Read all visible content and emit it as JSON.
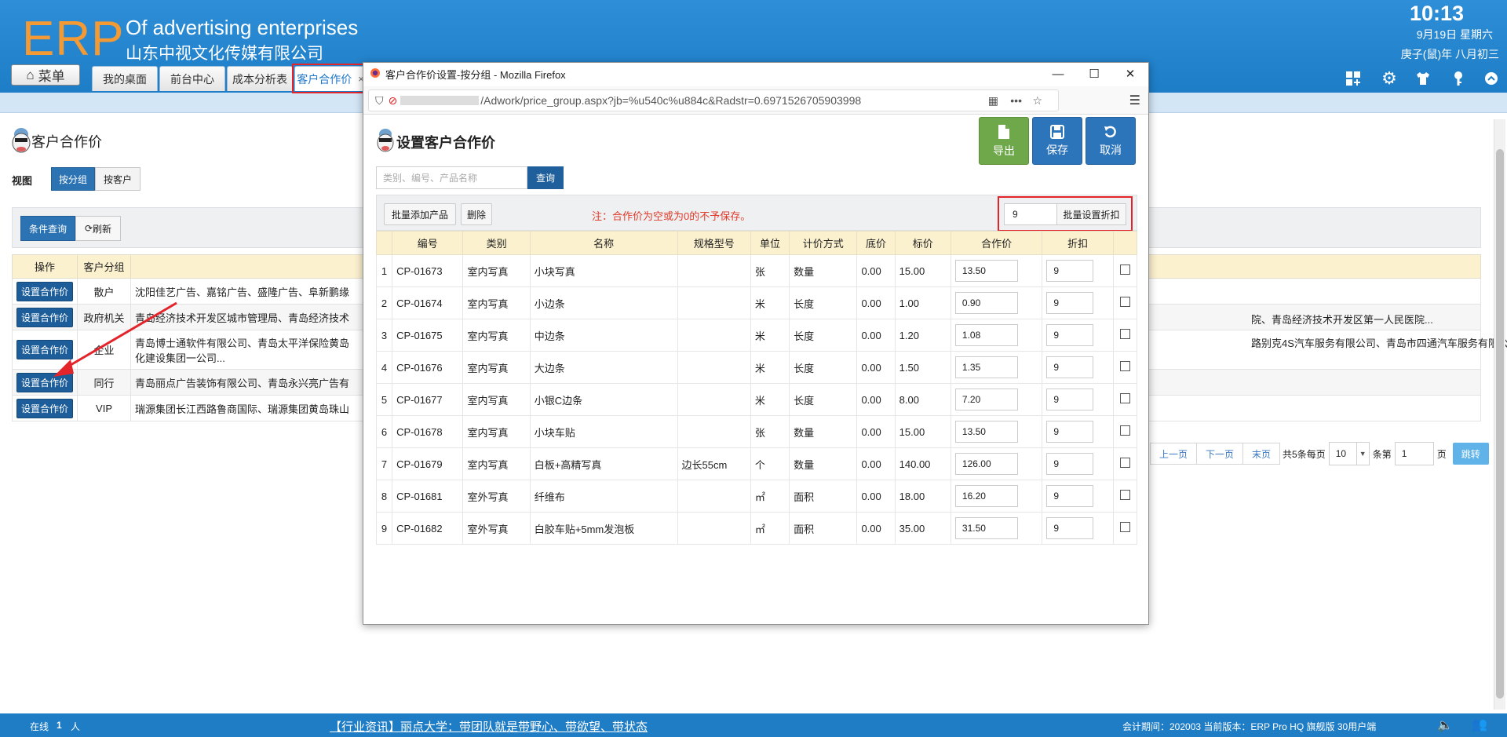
{
  "header": {
    "logo": "ERP",
    "brand_en": "Of advertising enterprises",
    "brand_cn": "山东中视文化传媒有限公司",
    "time": "10:13",
    "date": "9月19日 星期六",
    "lunar": "庚子(鼠)年 八月初三",
    "menu_label": "菜单",
    "tabs": [
      {
        "label": "我的桌面"
      },
      {
        "label": "前台中心"
      },
      {
        "label": "成本分析表"
      },
      {
        "label": "客户合作价",
        "close": "×"
      }
    ],
    "icons": [
      "grid-add-icon",
      "gear-icon",
      "shirt-icon",
      "key-icon",
      "collapse-icon"
    ]
  },
  "page": {
    "title": "客户合作价",
    "view_label": "视图",
    "view_by_group": "按分组",
    "view_by_customer": "按客户",
    "condition_query": "条件查询",
    "refresh": "刷新",
    "columns": [
      "操作",
      "客户分组"
    ],
    "rows": [
      {
        "op": "设置合作价",
        "group": "散户",
        "members": "沈阳佳艺广告、嘉铭广告、盛隆广告、阜新鹏缘"
      },
      {
        "op": "设置合作价",
        "group": "政府机关",
        "members": "青岛经济技术开发区城市管理局、青岛经济技术",
        "members_tail": "院、青岛经济技术开发区第一人民医院..."
      },
      {
        "op": "设置合作价",
        "group": "企业",
        "members": "青岛博士通软件有限公司、青岛太平洋保险黄岛",
        "members_line2": "化建设集团一公司...",
        "members_tail": "路别克4S汽车服务有限公司、青岛市四通汽车服务有限公司、青岛兴"
      },
      {
        "op": "设置合作价",
        "group": "同行",
        "members": "青岛丽点广告装饰有限公司、青岛永兴亮广告有"
      },
      {
        "op": "设置合作价",
        "group": "VIP",
        "members": "瑞源集团长江西路鲁商国际、瑞源集团黄岛珠山"
      }
    ],
    "pager": {
      "prev": "上一页",
      "next": "下一页",
      "last": "末页",
      "total_text": "共5条每页",
      "page_size": "10",
      "per_text": "条第",
      "page_no": "1",
      "page_unit": "页",
      "go": "跳转"
    }
  },
  "popup": {
    "window_title": "客户合作价设置-按分组 - Mozilla Firefox",
    "url": "/Adwork/price_group.aspx?jb=%u540c%u884c&Radstr=0.6971526705903998",
    "title": "设置客户合作价",
    "export": "导出",
    "save": "保存",
    "cancel": "取消",
    "search_placeholder": "类别、编号、产品名称",
    "search_btn": "查询",
    "batch_add": "批量添加产品",
    "delete": "删除",
    "note": "注：合作价为空或为0的不予保存。",
    "batch_discount_value": "9",
    "batch_discount_btn": "批量设置折扣",
    "columns": [
      "",
      "编号",
      "类别",
      "名称",
      "规格型号",
      "单位",
      "计价方式",
      "底价",
      "标价",
      "合作价",
      "折扣",
      ""
    ],
    "rows": [
      {
        "no": "1",
        "code": "CP-01673",
        "cat": "室内写真",
        "name": "小块写真",
        "spec": "",
        "unit": "张",
        "pricing": "数量",
        "floor": "0.00",
        "list": "15.00",
        "coop": "13.50",
        "disc": "9"
      },
      {
        "no": "2",
        "code": "CP-01674",
        "cat": "室内写真",
        "name": "小边条",
        "spec": "",
        "unit": "米",
        "pricing": "长度",
        "floor": "0.00",
        "list": "1.00",
        "coop": "0.90",
        "disc": "9"
      },
      {
        "no": "3",
        "code": "CP-01675",
        "cat": "室内写真",
        "name": "中边条",
        "spec": "",
        "unit": "米",
        "pricing": "长度",
        "floor": "0.00",
        "list": "1.20",
        "coop": "1.08",
        "disc": "9"
      },
      {
        "no": "4",
        "code": "CP-01676",
        "cat": "室内写真",
        "name": "大边条",
        "spec": "",
        "unit": "米",
        "pricing": "长度",
        "floor": "0.00",
        "list": "1.50",
        "coop": "1.35",
        "disc": "9"
      },
      {
        "no": "5",
        "code": "CP-01677",
        "cat": "室内写真",
        "name": "小银C边条",
        "spec": "",
        "unit": "米",
        "pricing": "长度",
        "floor": "0.00",
        "list": "8.00",
        "coop": "7.20",
        "disc": "9"
      },
      {
        "no": "6",
        "code": "CP-01678",
        "cat": "室内写真",
        "name": "小块车贴",
        "spec": "",
        "unit": "张",
        "pricing": "数量",
        "floor": "0.00",
        "list": "15.00",
        "coop": "13.50",
        "disc": "9"
      },
      {
        "no": "7",
        "code": "CP-01679",
        "cat": "室内写真",
        "name": "白板+高精写真",
        "spec": "边长55cm",
        "unit": "个",
        "pricing": "数量",
        "floor": "0.00",
        "list": "140.00",
        "coop": "126.00",
        "disc": "9"
      },
      {
        "no": "8",
        "code": "CP-01681",
        "cat": "室外写真",
        "name": "纤维布",
        "spec": "",
        "unit": "㎡",
        "pricing": "面积",
        "floor": "0.00",
        "list": "18.00",
        "coop": "16.20",
        "disc": "9"
      },
      {
        "no": "9",
        "code": "CP-01682",
        "cat": "室外写真",
        "name": "白胶车贴+5mm发泡板",
        "spec": "",
        "unit": "㎡",
        "pricing": "面积",
        "floor": "0.00",
        "list": "35.00",
        "coop": "31.50",
        "disc": "9"
      }
    ]
  },
  "footer": {
    "online_label": "在线",
    "online_count": "1",
    "online_unit": "人",
    "news": "【行业资讯】丽点大学：带团队就是带野心、带欲望、带状态",
    "info": "会计期间：202003 当前版本：ERP Pro HQ 旗舰版 30用户端"
  },
  "colors": {
    "primary": "#1f7dc6",
    "accent_orange": "#f39a34",
    "highlight_red": "#e3242b",
    "header_yellow": "#fbf1cf"
  }
}
